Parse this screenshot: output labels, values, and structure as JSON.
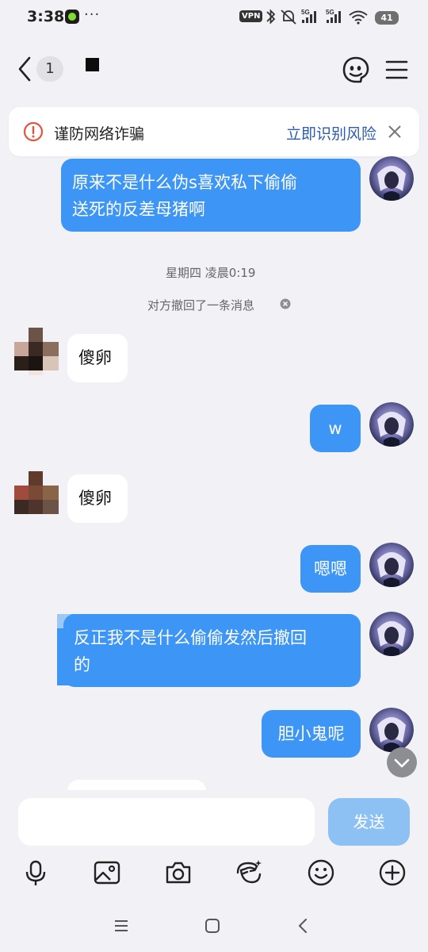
{
  "status_bar": {
    "time": "3:38",
    "dots": "···",
    "vpn": "VPN",
    "network_1": "5G",
    "network_2": "5G",
    "battery": "41"
  },
  "header": {
    "back_count": "1"
  },
  "fraud_banner": {
    "text": "谨防网络诈骗",
    "action": "立即识别风险"
  },
  "messages": [
    {
      "side": "out",
      "text_line1": "原来不是什么伪s喜欢私下偷偷",
      "text_line2": "送死的反差母猪啊"
    },
    {
      "side": "meta",
      "timestamp": "星期四 凌晨0:19"
    },
    {
      "side": "meta",
      "recall": "对方撤回了一条消息"
    },
    {
      "side": "in",
      "text": "傻卵"
    },
    {
      "side": "out",
      "text": "w"
    },
    {
      "side": "in",
      "text": "傻卵"
    },
    {
      "side": "out",
      "text": "嗯嗯"
    },
    {
      "side": "out",
      "text_line1": "反正我不是什么偷偷发然后撤回",
      "text_line2": "的"
    },
    {
      "side": "out",
      "text": "胆小鬼呢"
    }
  ],
  "input": {
    "send_label": "发送"
  },
  "colors": {
    "outgoing_bubble": "#3d95f5",
    "incoming_bubble": "#ffffff",
    "send_disabled": "#8dc0f3",
    "banner_action": "#2b5cad"
  },
  "icons": {
    "toolbar": [
      "microphone-icon",
      "image-icon",
      "camera-icon",
      "sticker-icon",
      "emoji-icon",
      "plus-icon"
    ],
    "nav": [
      "menu-icon",
      "home-icon",
      "back-icon"
    ]
  }
}
